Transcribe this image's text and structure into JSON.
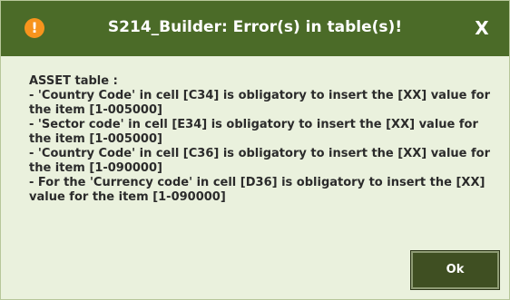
{
  "window": {
    "title": "S214_Builder: Error(s) in table(s)!",
    "close_label": "X",
    "warning_icon": "warning-icon",
    "warning_glyph": "!"
  },
  "message": {
    "text": "ASSET table :\n- 'Country Code' in cell [C34] is obligatory to insert the [XX] value for the item [1-005000]\n- 'Sector code' in cell [E34] is obligatory to insert the [XX] value for the item [1-005000]\n- 'Country Code' in cell [C36] is obligatory to insert the [XX] value for the item [1-090000]\n- For the 'Currency code' in cell [D36] is obligatory to insert the [XX] value for the item [1-090000]"
  },
  "buttons": {
    "ok_label": "Ok"
  },
  "colors": {
    "titlebar": "#4b6b28",
    "body": "#eaf1dd",
    "warning_icon": "#f7941d",
    "ok_button": "#3f4f22"
  }
}
